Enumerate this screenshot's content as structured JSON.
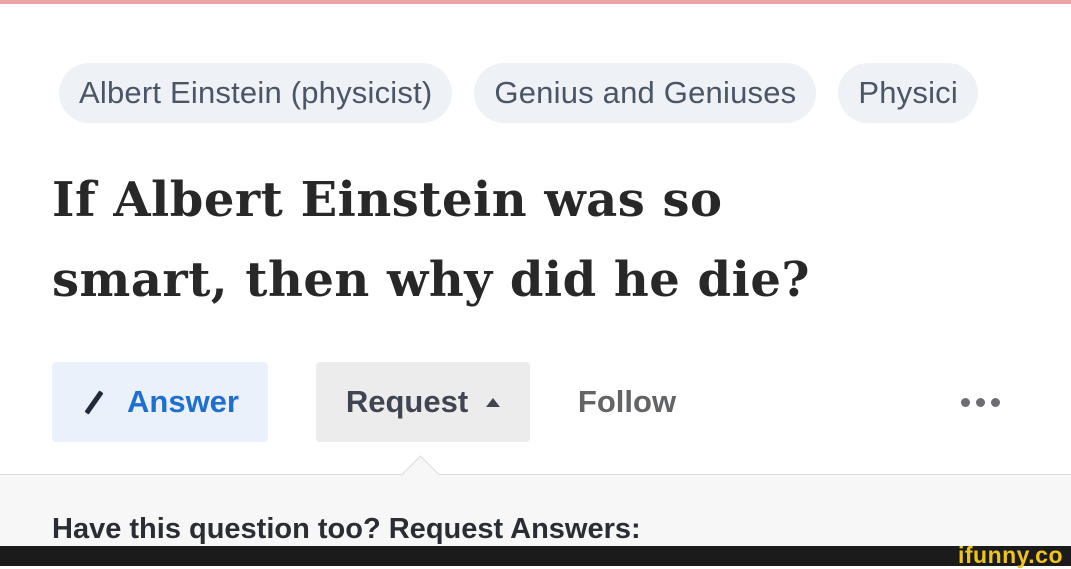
{
  "topics": [
    {
      "label": "Albert Einstein (physicist)"
    },
    {
      "label": "Genius and Geniuses"
    },
    {
      "label": "Physici"
    }
  ],
  "question": {
    "title_line1": "If Albert Einstein was so",
    "title_line2": "smart, then why did he die?"
  },
  "actions": {
    "answer_label": "Answer",
    "request_label": "Request",
    "follow_label": "Follow"
  },
  "request_panel": {
    "prompt": "Have this question too? Request Answers:"
  },
  "watermark": {
    "text": "ifunny.co"
  },
  "colors": {
    "accent_blue": "#1f6fd0",
    "watermark_yellow": "#f0c51b",
    "top_accent": "#e9a5a5"
  }
}
